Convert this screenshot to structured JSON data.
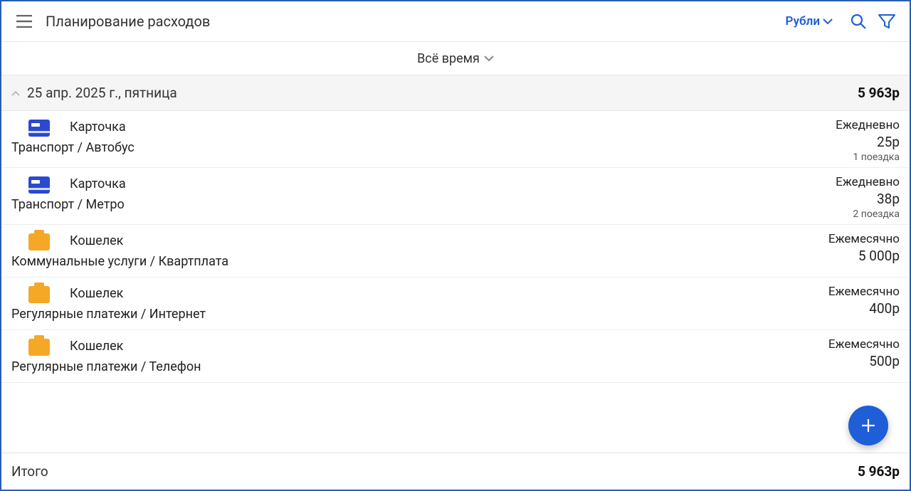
{
  "header": {
    "title": "Планирование расходов",
    "currency_label": "Рубли"
  },
  "period_bar": {
    "label": "Всё время"
  },
  "day": {
    "date_text": "25 апр. 2025 г., пятница",
    "total_text": "5 963р"
  },
  "rows": [
    {
      "icon": "card",
      "account": "Карточка",
      "category": "Транспорт / Автобус",
      "period": "Ежедневно",
      "amount": "25р",
      "note": "1 поездка"
    },
    {
      "icon": "card",
      "account": "Карточка",
      "category": "Транспорт / Метро",
      "period": "Ежедневно",
      "amount": "38р",
      "note": "2 поездка"
    },
    {
      "icon": "wallet",
      "account": "Кошелек",
      "category": "Коммунальные услуги / Квартплата",
      "period": "Ежемесячно",
      "amount": "5 000р",
      "note": ""
    },
    {
      "icon": "wallet",
      "account": "Кошелек",
      "category": "Регулярные платежи / Интернет",
      "period": "Ежемесячно",
      "amount": "400р",
      "note": ""
    },
    {
      "icon": "wallet",
      "account": "Кошелек",
      "category": "Регулярные платежи / Телефон",
      "period": "Ежемесячно",
      "amount": "500р",
      "note": ""
    }
  ],
  "footer": {
    "label": "Итого",
    "total_text": "5 963р"
  }
}
